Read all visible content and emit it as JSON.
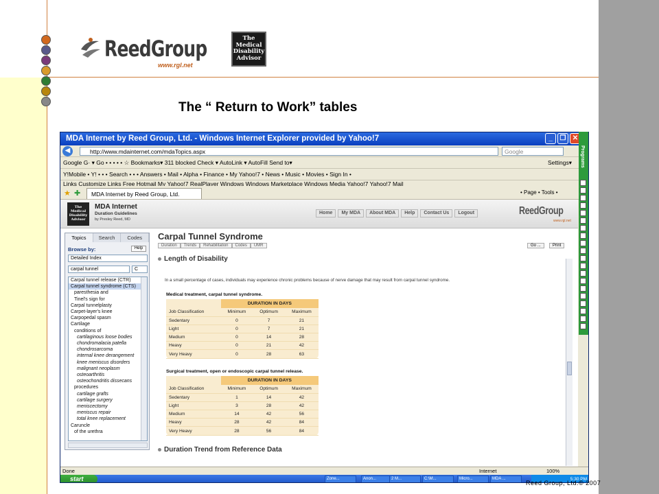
{
  "slide": {
    "logo_text": "ReedGroup",
    "logo_url": "www.rgl.net",
    "mda_badge": [
      "The",
      "Medical",
      "Disability",
      "Advisor"
    ],
    "title": "The “ Return to Work” tables",
    "credit": "Reed Group, Ltd.© 2007",
    "dot_colors": [
      "#d2691e",
      "#5a5a8a",
      "#7a3a7a",
      "#d99a2a",
      "#2e7d32",
      "#b8860b",
      "#888888"
    ]
  },
  "browser": {
    "window_title": "MDA Internet by Reed Group, Ltd. - Windows Internet Explorer provided by Yahoo!7",
    "address": "http://www.mdainternet.com/mdaTopics.aspx",
    "search_placeholder": "Google",
    "google_toolbar": "Google G· ▾   Go • • • •  •  ☆ Bookmarks▾  311 blocked  Check ▾  AutoLink ▾  AutoFill  Send to▾",
    "google_settings": "Settings▾",
    "yahoo_toolbar": "Y!Mobile • Y! • •   •  Search •  • •  Answers •  Mail •  Alpha •  Finance •  My Yahoo!7 •  News •  Music •  Movies •  Sign In •",
    "links_bar": "Links  Customize Links   Free Hotmail   My Yahoo!7   RealPlayer   Windows   Windows Marketplace   Windows Media   Yahoo!7   Yahoo!7 Mail",
    "tab_label": "MDA Internet by Reed Group, Ltd.",
    "cmd_bar": "• Page •   Tools •",
    "status_left": "Done",
    "status_zone": "Internet",
    "status_zoom": "100%",
    "ie_side_label": "Programs"
  },
  "mda_header": {
    "logo_lines": "The Medical Disability Advisor",
    "name": "MDA Internet",
    "sub1": "Duration Guidelines",
    "sub2": "by Presley Reed, MD",
    "nav": [
      "Home",
      "My MDA",
      "About MDA",
      "Help",
      "Contact Us",
      "Logout"
    ],
    "brand": "ReedGroup",
    "brand_url": "www.rgl.net"
  },
  "sidepanel": {
    "tabs": [
      "Topics",
      "Search",
      "Codes"
    ],
    "browse_label": "Browse by:",
    "help": "Help",
    "index_select": "Detailed Index",
    "search_value": "carpal tunnel",
    "search_letter": "C",
    "items": [
      {
        "t": "Carpal tunnel release (CTR)",
        "lvl": 0,
        "sel": false
      },
      {
        "t": "Carpal tunnel syndrome (CTS)",
        "lvl": 0,
        "sel": true
      },
      {
        "t": "paresthesia and",
        "lvl": 1,
        "sel": false
      },
      {
        "t": "Tinel's sign for",
        "lvl": 1,
        "sel": false
      },
      {
        "t": "Carpal tunnelplasty",
        "lvl": 0,
        "sel": false
      },
      {
        "t": "Carpet-layer's knee",
        "lvl": 0,
        "sel": false
      },
      {
        "t": "Carpopedal spasm",
        "lvl": 0,
        "sel": false
      },
      {
        "t": "Cartilage",
        "lvl": 0,
        "sel": false
      },
      {
        "t": "conditions of",
        "lvl": 1,
        "sel": false
      },
      {
        "t": "cartilaginous loose bodies",
        "lvl": 2,
        "sel": false
      },
      {
        "t": "chondromalacia patella",
        "lvl": 2,
        "sel": false
      },
      {
        "t": "chondrosarcoma",
        "lvl": 2,
        "sel": false
      },
      {
        "t": "internal knee derangement",
        "lvl": 2,
        "sel": false
      },
      {
        "t": "knee meniscus disorders",
        "lvl": 2,
        "sel": false
      },
      {
        "t": "malignant neoplasm",
        "lvl": 2,
        "sel": false
      },
      {
        "t": "osteoarthritis",
        "lvl": 2,
        "sel": false
      },
      {
        "t": "osteochondritis dissecans",
        "lvl": 2,
        "sel": false
      },
      {
        "t": "procedures",
        "lvl": 1,
        "sel": false
      },
      {
        "t": "cartilage grafts",
        "lvl": 2,
        "sel": false
      },
      {
        "t": "cartilage surgery",
        "lvl": 2,
        "sel": false
      },
      {
        "t": "meniscectomy",
        "lvl": 2,
        "sel": false
      },
      {
        "t": "meniscus repair",
        "lvl": 2,
        "sel": false
      },
      {
        "t": "total knee replacement",
        "lvl": 2,
        "sel": false
      },
      {
        "t": "Caruncle",
        "lvl": 0,
        "sel": false
      },
      {
        "t": "of the urethra",
        "lvl": 1,
        "sel": false
      }
    ]
  },
  "content": {
    "title": "Carpal Tunnel Syndrome",
    "subnav": [
      "Duration",
      "Trends",
      "Rehabilitation",
      "Codes",
      "UMR"
    ],
    "go": "Go ...",
    "print": "Print",
    "section1": "Length of Disability",
    "paragraph": "In a small percentage of cases, individuals may experience chronic problems because of nerve damage that may result from carpal tunnel syndrome.",
    "section2": "Duration Trend from Reference Data",
    "tables": [
      {
        "label": "Medical treatment, carpal tunnel syndrome.",
        "caption": "DURATION IN DAYS",
        "columns": [
          "Job Classification",
          "Minimum",
          "Optimum",
          "Maximum"
        ],
        "rows": [
          [
            "Sedentary",
            "0",
            "7",
            "21"
          ],
          [
            "Light",
            "0",
            "7",
            "21"
          ],
          [
            "Medium",
            "0",
            "14",
            "28"
          ],
          [
            "Heavy",
            "0",
            "21",
            "42"
          ],
          [
            "Very Heavy",
            "0",
            "28",
            "63"
          ]
        ]
      },
      {
        "label": "Surgical treatment, open or endoscopic carpal tunnel release.",
        "caption": "DURATION IN DAYS",
        "columns": [
          "Job Classification",
          "Minimum",
          "Optimum",
          "Maximum"
        ],
        "rows": [
          [
            "Sedentary",
            "1",
            "14",
            "42"
          ],
          [
            "Light",
            "3",
            "28",
            "42"
          ],
          [
            "Medium",
            "14",
            "42",
            "56"
          ],
          [
            "Heavy",
            "28",
            "42",
            "84"
          ],
          [
            "Very Heavy",
            "28",
            "56",
            "84"
          ]
        ]
      }
    ]
  },
  "taskbar": {
    "start": "start",
    "items": [
      "Zone...",
      "Anon...",
      "2 M...",
      "C:\\M...",
      "Micro...",
      "MDA ..."
    ],
    "clock": "5:30 PM"
  }
}
